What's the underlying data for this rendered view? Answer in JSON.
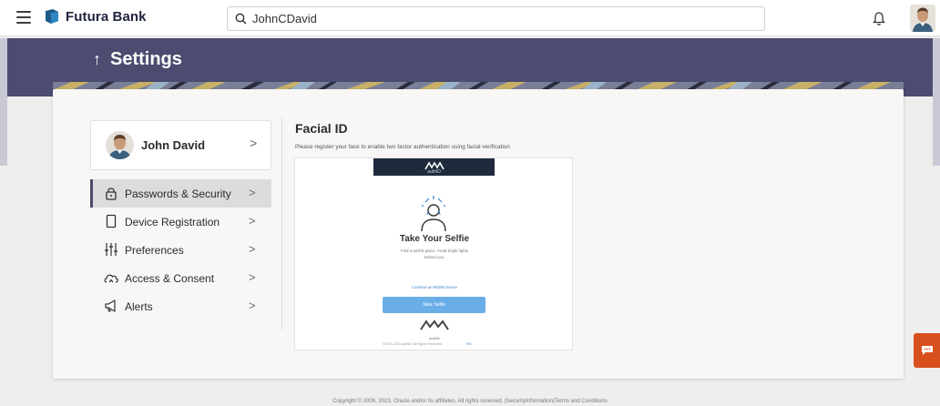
{
  "app": {
    "brand": "Futura Bank"
  },
  "search": {
    "value": "JohnCDavid",
    "placeholder": ""
  },
  "header": {
    "title": "Settings",
    "back_arrow": "↑"
  },
  "profile": {
    "name": "John David"
  },
  "menu": {
    "items": [
      {
        "label": "Passwords & Security",
        "icon": "lock-icon",
        "active": true
      },
      {
        "label": "Device Registration",
        "icon": "phone-icon",
        "active": false
      },
      {
        "label": "Preferences",
        "icon": "sliders-icon",
        "active": false
      },
      {
        "label": "Access & Consent",
        "icon": "cloud-consent-icon",
        "active": false
      },
      {
        "label": "Alerts",
        "icon": "megaphone-icon",
        "active": false
      }
    ],
    "chevron": ">"
  },
  "content": {
    "title": "Facial ID",
    "description": "Please register your face to enable two factor authentication using facial verification",
    "preview": {
      "header_logo_text": "authID",
      "title": "Take Your Selfie",
      "subtitle_line1": "Find a well-lit place. Avoid bright lights",
      "subtitle_line2": "behind you.",
      "link": "Continue on Mobile Device",
      "button": "Take Selfie",
      "foot_logo_text": "authID",
      "footer_left": "©2015-2023 authID. All Rights Reserved.",
      "footer_right": "EN"
    }
  },
  "footer": {
    "text": "Copyright © 2006, 2023, Oracle and/or its affiliates. All rights reserved. |SecurityInformation|Terms and Conditions"
  },
  "colors": {
    "band": "#4b4c6f",
    "accent_button": "#6aaee8",
    "chat": "#d9501f",
    "link": "#3b7fcf"
  }
}
